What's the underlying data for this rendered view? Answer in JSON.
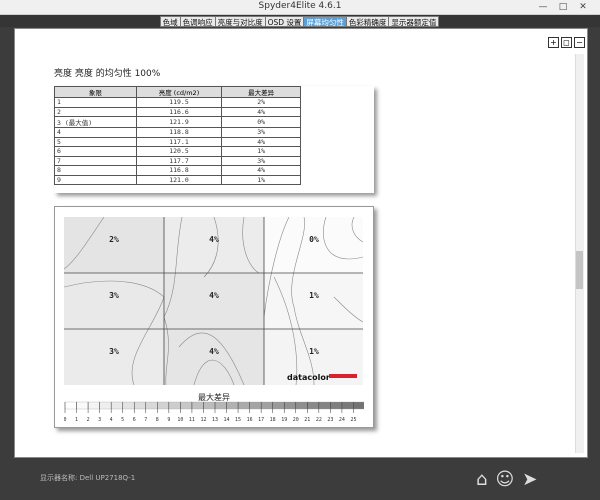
{
  "window": {
    "title": "Spyder4Elite 4.6.1",
    "min_glyph": "—",
    "max_glyph": "□",
    "close_glyph": "✕"
  },
  "tabs": [
    {
      "label": "色域"
    },
    {
      "label": "色调响应"
    },
    {
      "label": "亮度与对比度"
    },
    {
      "label": "OSD 设置"
    },
    {
      "label": "屏幕均匀性",
      "active": true
    },
    {
      "label": "色彩精确度"
    },
    {
      "label": "显示器额定值"
    }
  ],
  "zoom": {
    "zoom_in_glyph": "+",
    "zoom_fit_glyph": "◻",
    "zoom_out_glyph": "−"
  },
  "report": {
    "section_title": "亮度 亮度 的均匀性 100%",
    "table": {
      "headers": [
        "象限",
        "亮度 (cd/m2)",
        "最大差异"
      ],
      "rows": [
        [
          "1",
          "119.5",
          "2%"
        ],
        [
          "2",
          "116.6",
          "4%"
        ],
        [
          "3 (最大值)",
          "121.9",
          "0%"
        ],
        [
          "4",
          "118.8",
          "3%"
        ],
        [
          "5",
          "117.1",
          "4%"
        ],
        [
          "6",
          "120.5",
          "1%"
        ],
        [
          "7",
          "117.7",
          "3%"
        ],
        [
          "8",
          "116.8",
          "4%"
        ],
        [
          "9",
          "121.0",
          "1%"
        ]
      ]
    },
    "map": {
      "cells": [
        "2%",
        "4%",
        "0%",
        "3%",
        "4%",
        "1%",
        "3%",
        "4%",
        "1%"
      ],
      "logo": "datacolor",
      "logo_bar_color": "#d9202e",
      "legend_title": "最大差异",
      "legend_ticks": [
        "0",
        "1",
        "2",
        "3",
        "4",
        "5",
        "6",
        "7",
        "8",
        "9",
        "10",
        "11",
        "12",
        "13",
        "14",
        "15",
        "16",
        "17",
        "18",
        "19",
        "20",
        "21",
        "22",
        "23",
        "24",
        "25"
      ]
    },
    "cutoff_text": "亮度 亮度 的均匀性"
  },
  "status": {
    "display_name": "显示器名称: Dell UP2718Q-1"
  },
  "colors": {
    "active_tab": "#5aa0d8",
    "panel_bg": "#ffffff",
    "chrome_bg": "#3c3c3c"
  }
}
